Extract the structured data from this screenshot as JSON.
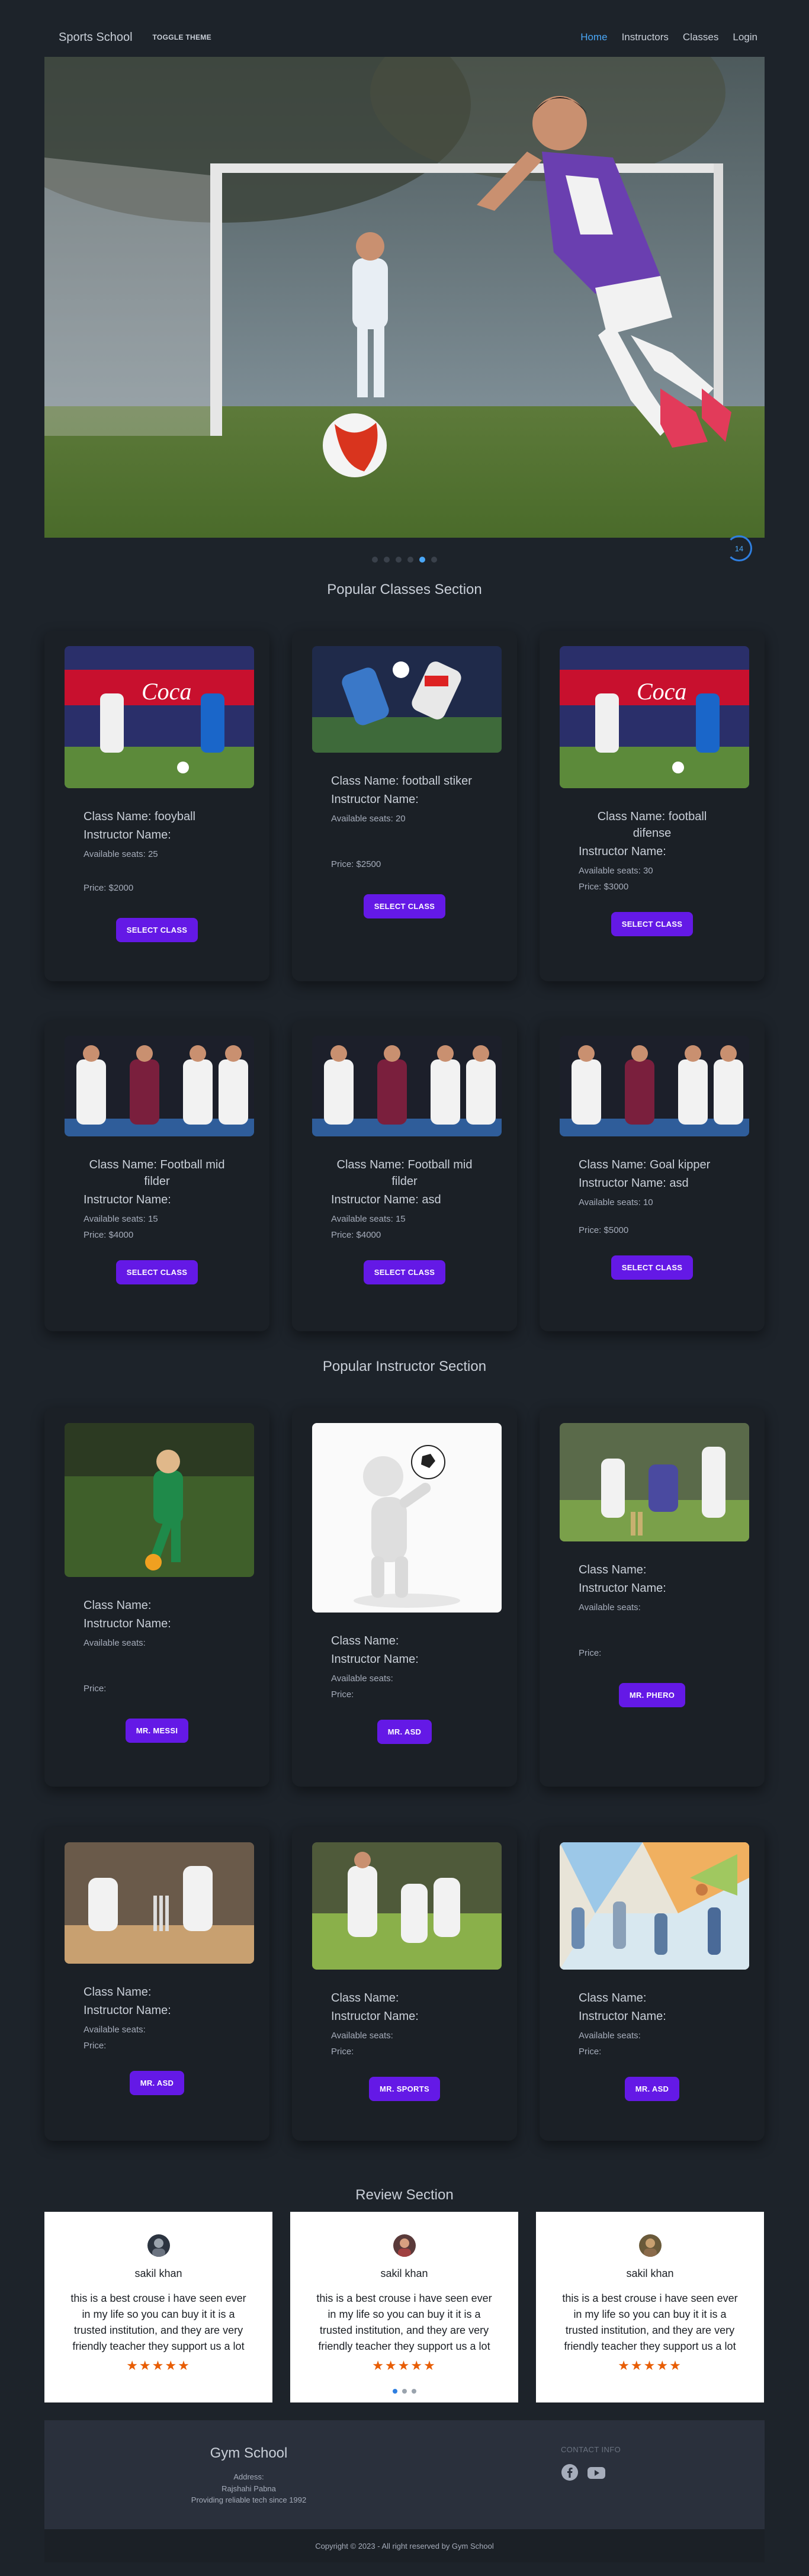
{
  "navbar": {
    "brand": "Sports School",
    "toggle_label": "TOGGLE THEME",
    "links": [
      "Home",
      "Instructors",
      "Classes",
      "Login"
    ]
  },
  "hero": {
    "autoplay_counter": "14"
  },
  "popular_classes": {
    "title": "Popular Classes Section",
    "cards": [
      {
        "name": "Class Name: fooyball",
        "instructor": "Instructor Name:",
        "seats": "Available seats: 25",
        "price": "Price: $2000",
        "button": "SELECT CLASS"
      },
      {
        "name": "Class Name: football stiker",
        "instructor": "Instructor Name:",
        "seats": "Available seats: 20",
        "price": "Price: $2500",
        "button": "SELECT CLASS"
      },
      {
        "name": "Class Name: football difense",
        "instructor": "Instructor Name:",
        "seats": "Available seats: 30",
        "price": "Price: $3000",
        "button": "SELECT CLASS"
      },
      {
        "name": "Class Name: Football mid filder",
        "instructor": "Instructor Name:",
        "seats": "Available seats: 15",
        "price": "Price: $4000",
        "button": "SELECT CLASS"
      },
      {
        "name": "Class Name: Football mid filder",
        "instructor": "Instructor Name: asd",
        "seats": "Available seats: 15",
        "price": "Price: $4000",
        "button": "SELECT CLASS"
      },
      {
        "name": "Class Name: Goal kipper",
        "instructor": "Instructor Name: asd",
        "seats": "Available seats: 10",
        "price": "Price: $5000",
        "button": "SELECT CLASS"
      }
    ]
  },
  "popular_instructors": {
    "title": "Popular Instructor Section",
    "cards": [
      {
        "name": "Class Name:",
        "instructor": "Instructor Name:",
        "seats": "Available seats:",
        "price": "Price:",
        "button": "MR. MESSI"
      },
      {
        "name": "Class Name:",
        "instructor": "Instructor Name:",
        "seats": "Available seats:",
        "price": "Price:",
        "button": "MR. ASD"
      },
      {
        "name": "Class Name:",
        "instructor": "Instructor Name:",
        "seats": "Available seats:",
        "price": "Price:",
        "button": "MR. PHERO"
      },
      {
        "name": "Class Name:",
        "instructor": "Instructor Name:",
        "seats": "Available seats:",
        "price": "Price:",
        "button": "MR. ASD"
      },
      {
        "name": "Class Name:",
        "instructor": "Instructor Name:",
        "seats": "Available seats:",
        "price": "Price:",
        "button": "MR. SPORTS"
      },
      {
        "name": "Class Name:",
        "instructor": "Instructor Name:",
        "seats": "Available seats:",
        "price": "Price:",
        "button": "MR. ASD"
      }
    ]
  },
  "reviews": {
    "title": "Review Section",
    "items": [
      {
        "name": "sakil khan",
        "text": "this is a best crouse i have seen ever in my life so you can buy it it is a trusted institution, and they are very friendly teacher they support us a lot",
        "stars": "★★★★★"
      },
      {
        "name": "sakil khan",
        "text": "this is a best crouse i have seen ever in my life so you can buy it it is a trusted institution, and they are very friendly teacher they support us a lot",
        "stars": "★★★★★"
      },
      {
        "name": "sakil khan",
        "text": "this is a best crouse i have seen ever in my life so you can buy it it is a trusted institution, and they are very friendly teacher they support us a lot",
        "stars": "★★★★★"
      }
    ]
  },
  "footer": {
    "title": "Gym School",
    "address_label": "Address:",
    "address": "Rajshahi Pabna",
    "tagline": "Providing reliable tech since 1992",
    "contact_label": "CONTACT INFO",
    "icons": [
      "facebook-icon",
      "youtube-icon"
    ],
    "copyright": "Copyright © 2023 - All right reserved by Gym School"
  },
  "colors": {
    "accent": "#6419e6",
    "link_active": "#4aa7f7",
    "background": "#1d232a",
    "star": "#e85d04"
  }
}
